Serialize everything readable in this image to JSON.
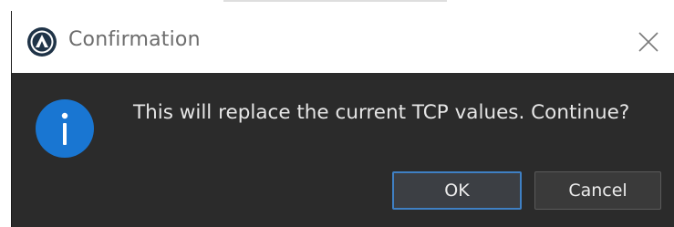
{
  "dialog": {
    "title": "Confirmation",
    "message": "This will replace the current TCP values. Continue?",
    "ok_label": "OK",
    "cancel_label": "Cancel",
    "icons": {
      "app": "app-logo-icon",
      "close": "close-icon",
      "info": "info-icon"
    }
  },
  "colors": {
    "title_bar": "#ffffff",
    "body": "#2b2b2b",
    "info_blue": "#1976d2",
    "ok_border": "#3f80c4",
    "text": "#e6e6e6"
  }
}
